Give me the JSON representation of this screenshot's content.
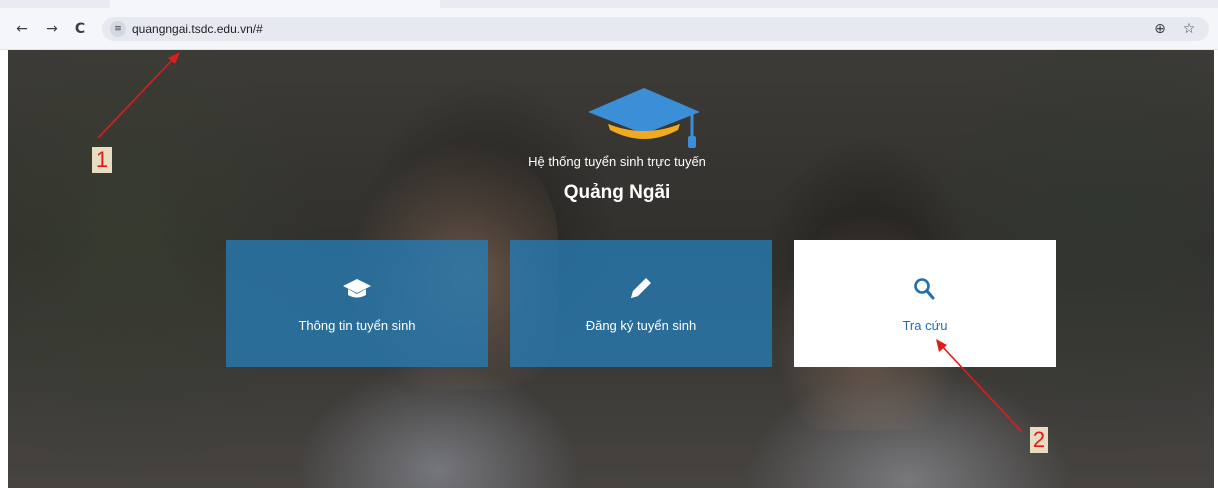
{
  "browser": {
    "url": "quangngai.tsdc.edu.vn/#",
    "back_glyph": "←",
    "forward_glyph": "→",
    "reload_glyph": "C",
    "site_info_glyph": "≡",
    "zoom_glyph": "⊕",
    "star_glyph": "☆"
  },
  "hero": {
    "subtitle": "Hệ thống tuyển sinh trực tuyến",
    "title": "Quảng Ngãi"
  },
  "cards": [
    {
      "label": "Thông tin tuyển sinh",
      "icon": "graduation-cap-icon"
    },
    {
      "label": "Đăng ký tuyển sinh",
      "icon": "pencil-icon"
    },
    {
      "label": "Tra cứu",
      "icon": "search-icon"
    }
  ],
  "annotations": [
    {
      "label": "1"
    },
    {
      "label": "2"
    }
  ],
  "colors": {
    "card_blue": "#277cb5",
    "card_white": "#ffffff",
    "link_blue": "#1f6fb2",
    "logo_blue": "#3a8fd6",
    "logo_gold": "#f2a922",
    "annotation_red": "#e01b1b"
  }
}
